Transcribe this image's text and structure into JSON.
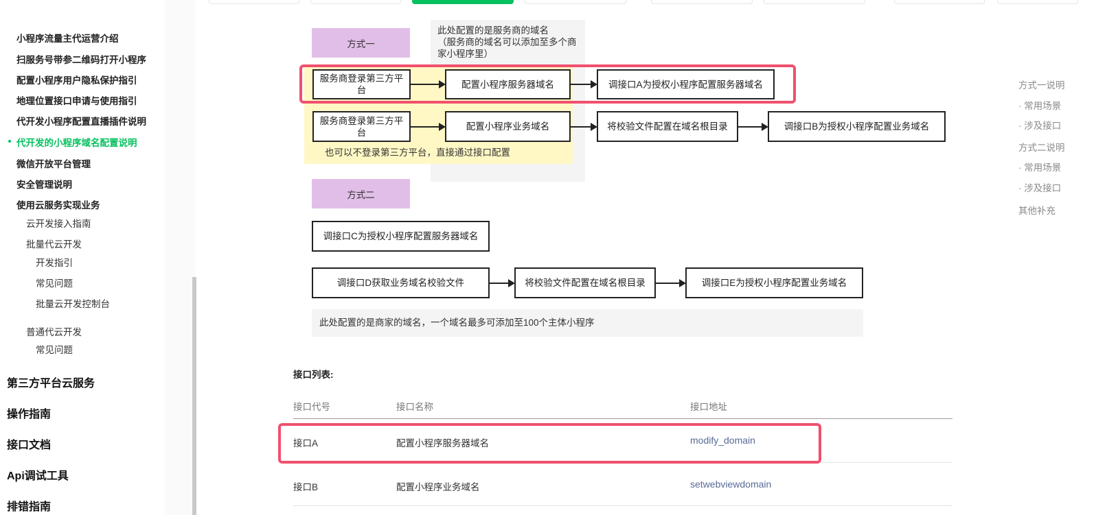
{
  "sidebar": {
    "items": [
      {
        "label": "小程序流量主代运营介绍"
      },
      {
        "label": "扫服务号带参二维码打开小程序"
      },
      {
        "label": "配置小程序用户隐私保护指引"
      },
      {
        "label": "地理位置接口申请与使用指引"
      },
      {
        "label": "代开发小程序配置直播插件说明"
      },
      {
        "label": "代开发的小程序域名配置说明",
        "active": true
      },
      {
        "label": "微信开放平台管理"
      },
      {
        "label": "安全管理说明"
      },
      {
        "label": "使用云服务实现业务"
      }
    ],
    "sub_items": [
      {
        "label": "云开发接入指南"
      },
      {
        "label": "批量代云开发"
      },
      {
        "label": "开发指引"
      },
      {
        "label": "常见问题"
      },
      {
        "label": "批量云开发控制台"
      },
      {
        "label": "普通代云开发"
      },
      {
        "label": "常见问题"
      }
    ],
    "top_items": [
      {
        "label": "第三方平台云服务"
      },
      {
        "label": "操作指南"
      },
      {
        "label": "接口文档"
      },
      {
        "label": "Api调试工具"
      },
      {
        "label": "排错指南"
      }
    ]
  },
  "diagram": {
    "method1": "方式一",
    "method2": "方式二",
    "note_provider": "此处配置的是服务商的域名\n（服务商的域名可以添加至多个商家小程序里）",
    "row1": [
      "服务商登录第三方平台",
      "配置小程序服务器域名",
      "调接口A为授权小程序配置服务器域名"
    ],
    "row2": [
      "服务商登录第三方平台",
      "配置小程序业务域名",
      "将校验文件配置在域名根目录",
      "调接口B为授权小程序配置业务域名"
    ],
    "note_yellow": "也可以不登录第三方平台，直接通过接口配置",
    "row3": [
      "调接口C为授权小程序配置服务器域名"
    ],
    "row4": [
      "调接口D获取业务域名校验文件",
      "将校验文件配置在域名根目录",
      "调接口E为授权小程序配置业务域名"
    ],
    "note_merchant": "此处配置的是商家的域名，一个域名最多可添加至100个主体小程序"
  },
  "api_table": {
    "title": "接口列表:",
    "columns": [
      "接口代号",
      "接口名称",
      "接口地址"
    ],
    "rows": [
      {
        "code": "接口A",
        "name": "配置小程序服务器域名",
        "url": "modify_domain"
      },
      {
        "code": "接口B",
        "name": "配置小程序业务域名",
        "url": "setwebviewdomain"
      }
    ]
  },
  "toc": [
    {
      "label": "方式一说明"
    },
    {
      "label": "· 常用场景"
    },
    {
      "label": "· 涉及接口"
    },
    {
      "label": "方式二说明"
    },
    {
      "label": "· 常用场景"
    },
    {
      "label": "· 涉及接口"
    },
    {
      "label": "其他补充"
    }
  ],
  "colors": {
    "accent": "#07c160",
    "highlight": "#f0506e",
    "method_tag": "#e1bee7",
    "note_yellow": "#fff8c5",
    "link": "#576b95"
  }
}
